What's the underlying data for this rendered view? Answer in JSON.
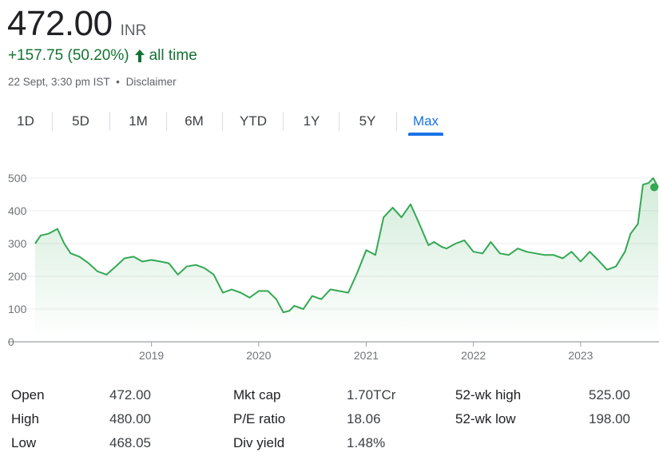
{
  "quote": {
    "price": "472.00",
    "currency": "INR",
    "change": "+157.75 (50.20%)",
    "change_period": "all time",
    "timestamp": "22 Sept, 3:30 pm IST",
    "separator": "•",
    "disclaimer": "Disclaimer"
  },
  "colors": {
    "positive": "#137333",
    "line": "#34a853",
    "active_tab": "#1a73e8"
  },
  "icons": {
    "change_arrow": "arrow-up-icon"
  },
  "tabs": [
    {
      "label": "1D",
      "active": false
    },
    {
      "label": "5D",
      "active": false
    },
    {
      "label": "1M",
      "active": false
    },
    {
      "label": "6M",
      "active": false
    },
    {
      "label": "YTD",
      "active": false
    },
    {
      "label": "1Y",
      "active": false
    },
    {
      "label": "5Y",
      "active": false
    },
    {
      "label": "Max",
      "active": true
    }
  ],
  "chart_data": {
    "type": "area",
    "xlim": [
      "2017-12-01",
      "2023-09-22"
    ],
    "ylim": [
      0,
      500
    ],
    "y_ticks": [
      0,
      100,
      200,
      300,
      400,
      500
    ],
    "x_ticks": [
      "2019",
      "2020",
      "2021",
      "2022",
      "2023"
    ],
    "grid": true,
    "series": [
      {
        "x": [
          "2017-12-01",
          "2017-12-20",
          "2018-01-15",
          "2018-02-15",
          "2018-03-10",
          "2018-04-01",
          "2018-05-01",
          "2018-06-01",
          "2018-07-01",
          "2018-08-01",
          "2018-09-01",
          "2018-10-01",
          "2018-11-01",
          "2018-12-01",
          "2019-01-01",
          "2019-02-01",
          "2019-03-01",
          "2019-04-01",
          "2019-05-01",
          "2019-06-01",
          "2019-07-01",
          "2019-08-01",
          "2019-09-01",
          "2019-10-01",
          "2019-11-01",
          "2019-12-01",
          "2020-01-01",
          "2020-02-01",
          "2020-03-01",
          "2020-03-25",
          "2020-04-15",
          "2020-05-01",
          "2020-06-01",
          "2020-07-01",
          "2020-08-01",
          "2020-09-01",
          "2020-10-01",
          "2020-11-01",
          "2020-12-01",
          "2021-01-01",
          "2021-02-01",
          "2021-03-01",
          "2021-04-01",
          "2021-05-01",
          "2021-06-01",
          "2021-07-01",
          "2021-08-01",
          "2021-08-20",
          "2021-09-15",
          "2021-10-01",
          "2021-11-01",
          "2021-12-01",
          "2022-01-01",
          "2022-02-01",
          "2022-03-01",
          "2022-04-01",
          "2022-05-01",
          "2022-06-01",
          "2022-07-01",
          "2022-08-01",
          "2022-09-01",
          "2022-10-01",
          "2022-11-01",
          "2022-12-01",
          "2023-01-01",
          "2023-02-01",
          "2023-03-01",
          "2023-04-01",
          "2023-05-01",
          "2023-06-01",
          "2023-06-20",
          "2023-07-15",
          "2023-08-01",
          "2023-08-20",
          "2023-09-05",
          "2023-09-22"
        ],
        "y": [
          300,
          325,
          330,
          345,
          300,
          270,
          260,
          240,
          215,
          205,
          230,
          255,
          260,
          245,
          250,
          245,
          240,
          205,
          230,
          235,
          225,
          205,
          150,
          160,
          150,
          135,
          155,
          155,
          130,
          90,
          95,
          110,
          100,
          140,
          130,
          160,
          155,
          150,
          210,
          280,
          265,
          380,
          410,
          380,
          420,
          360,
          295,
          305,
          290,
          285,
          300,
          310,
          275,
          270,
          305,
          270,
          265,
          285,
          275,
          270,
          265,
          265,
          255,
          275,
          245,
          275,
          250,
          220,
          230,
          275,
          330,
          360,
          480,
          485,
          500,
          472
        ]
      }
    ]
  },
  "stats": [
    [
      {
        "label": "Open",
        "value": "472.00"
      },
      {
        "label": "High",
        "value": "480.00"
      },
      {
        "label": "Low",
        "value": "468.05"
      }
    ],
    [
      {
        "label": "Mkt cap",
        "value": "1.70TCr"
      },
      {
        "label": "P/E ratio",
        "value": "18.06"
      },
      {
        "label": "Div yield",
        "value": "1.48%"
      }
    ],
    [
      {
        "label": "52-wk high",
        "value": "525.00"
      },
      {
        "label": "52-wk low",
        "value": "198.00"
      }
    ]
  ]
}
